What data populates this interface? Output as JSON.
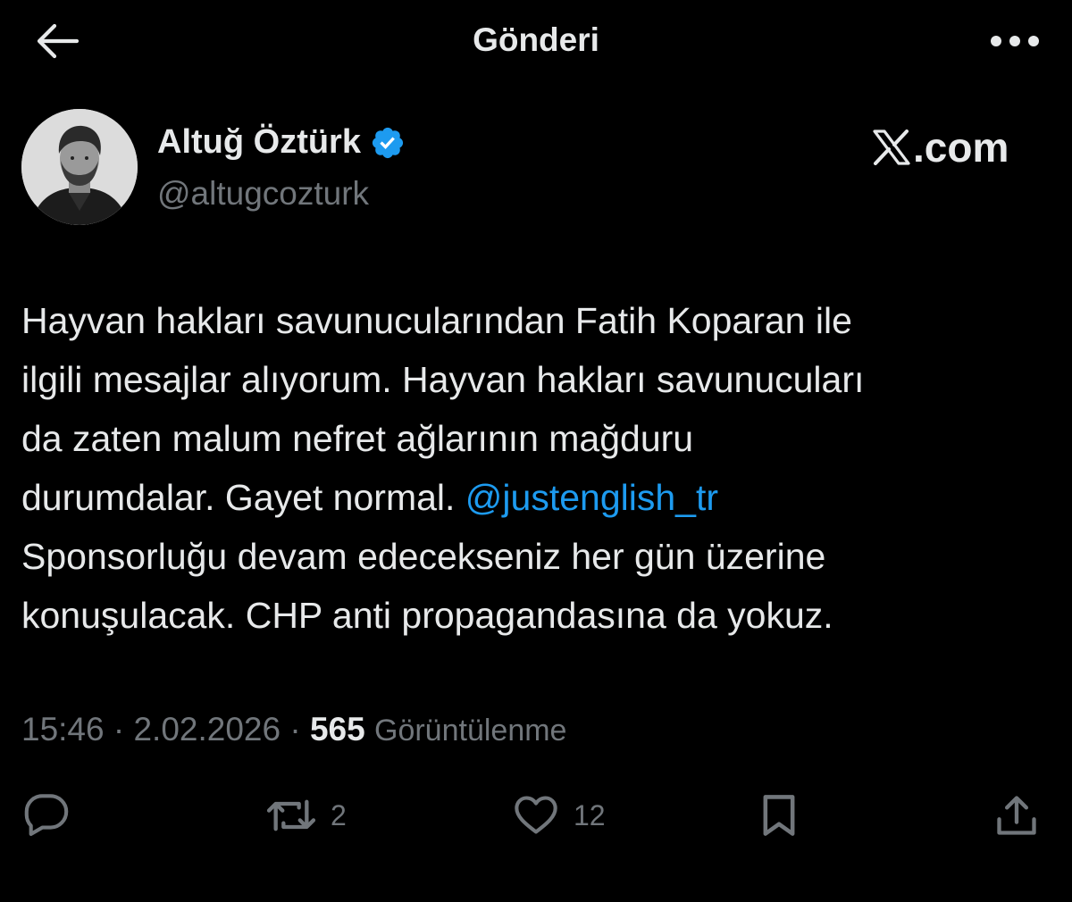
{
  "header": {
    "title": "Gönderi"
  },
  "author": {
    "display_name": "Altuğ Öztürk",
    "handle": "@altugcozturk",
    "verified": true
  },
  "watermark": "X.com",
  "tweet": {
    "lines": [
      {
        "text": "Hayvan hakları savunucularından Fatih Koparan ile"
      },
      {
        "text": "ilgili mesajlar alıyorum. Hayvan hakları savunucuları"
      },
      {
        "text": "da zaten malum nefret ağlarının mağduru"
      },
      {
        "text": "durumdalar. Gayet normal. ",
        "mention": "@justenglish_tr"
      },
      {
        "text": "Sponsorluğu devam edecekseniz her gün üzerine"
      },
      {
        "text": "konuşulacak. CHP anti propagandasına da yokuz."
      }
    ]
  },
  "meta": {
    "time": "15:46",
    "date": "2.02.2026",
    "separator": "·",
    "views_count": "565",
    "views_label": "Görüntülenme"
  },
  "actions": {
    "reply": {
      "icon": "reply-icon",
      "count": ""
    },
    "repost": {
      "icon": "repost-icon",
      "count": "2"
    },
    "like": {
      "icon": "heart-icon",
      "count": "12"
    },
    "bookmark": {
      "icon": "bookmark-icon",
      "count": ""
    },
    "share": {
      "icon": "share-icon",
      "count": ""
    }
  },
  "colors": {
    "background": "#000000",
    "text": "#e7e9ea",
    "muted": "#71767b",
    "link": "#1d9bf0",
    "verified": "#1d9bf0"
  }
}
